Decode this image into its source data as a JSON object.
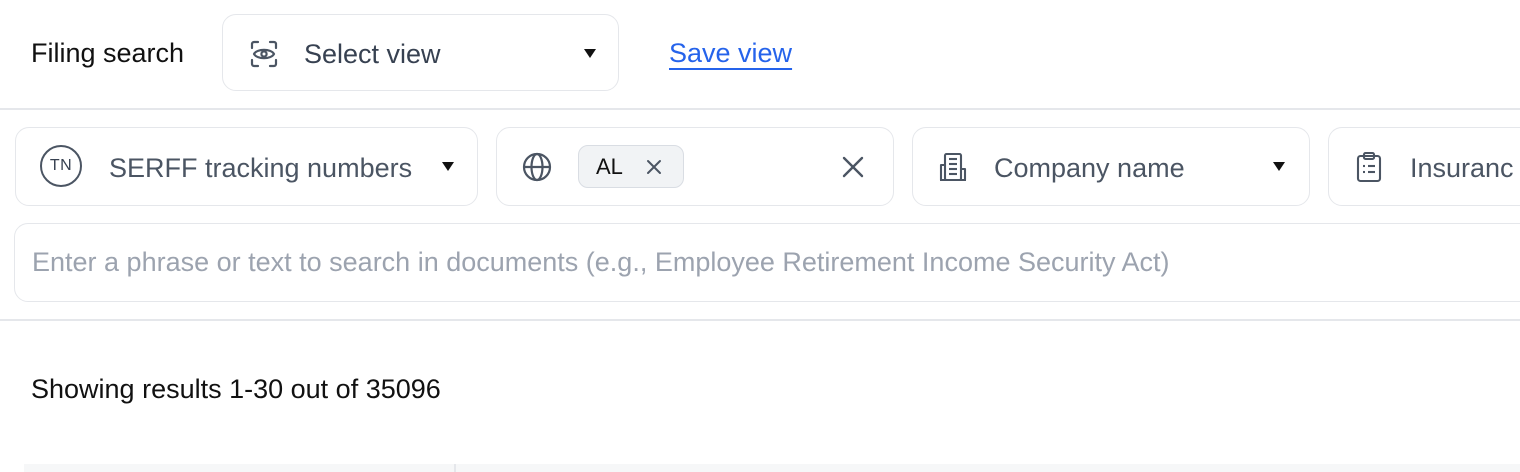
{
  "header": {
    "title": "Filing search",
    "view_select": {
      "icon": "eye-scan-icon",
      "label": "Select view",
      "caret": "caret-down-icon"
    },
    "save_view_label": "Save view"
  },
  "filters": [
    {
      "id": "serff",
      "icon": "tn-badge-icon",
      "icon_text": "TN",
      "label": "SERFF tracking numbers",
      "caret": "caret-down-icon"
    },
    {
      "id": "state",
      "icon": "globe-icon",
      "chips": [
        {
          "label": "AL",
          "remove_icon": "close-icon"
        }
      ],
      "clear_icon": "close-icon"
    },
    {
      "id": "company",
      "icon": "building-icon",
      "label": "Company name",
      "caret": "caret-down-icon"
    },
    {
      "id": "insurance",
      "icon": "clipboard-icon",
      "label": "Insuranc"
    }
  ],
  "search": {
    "placeholder": "Enter a phrase or text to search in documents (e.g., Employee Retirement Income Security Act)",
    "value": ""
  },
  "results_summary": "Showing results 1-30 out of 35096",
  "colors": {
    "accent": "#2563eb",
    "border": "#e5e7eb",
    "muted_text": "#4b5563",
    "placeholder": "#9ca3af"
  }
}
